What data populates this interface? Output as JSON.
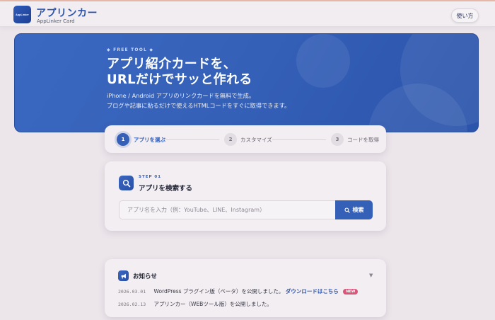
{
  "header": {
    "logo_text": "AppLinker",
    "title": "アプリンカー",
    "subtitle": "AppLinker Card",
    "howto_label": "使い方"
  },
  "hero": {
    "tag": "FREE TOOL",
    "title_line1": "アプリ紹介カードを、",
    "title_line2": "URLだけでサッと作れる",
    "desc_line1": "iPhone / Android アプリのリンクカードを無料で生成。",
    "desc_line2": "ブログや記事に貼るだけで使えるHTMLコードをすぐに取得できます。"
  },
  "steps": [
    {
      "num": "1",
      "label": "アプリを選ぶ",
      "active": true
    },
    {
      "num": "2",
      "label": "カスタマイズ",
      "active": false
    },
    {
      "num": "3",
      "label": "コードを取得",
      "active": false
    }
  ],
  "search_card": {
    "step_tag": "STEP 01",
    "title": "アプリを検索する",
    "placeholder": "アプリ名を入力（例：YouTube、LINE、Instagram）",
    "button_label": "検索",
    "icon": "search-icon"
  },
  "news": {
    "title": "お知らせ",
    "toggle": "▼",
    "items": [
      {
        "date": "2026.03.01",
        "text": "WordPress プラグイン版（ベータ）を公開しました。",
        "link": "ダウンロードはこちら",
        "badge": "NEW"
      },
      {
        "date": "2026.02.13",
        "text": "アプリンカー（WEBツール版）を公開しました。",
        "link": "",
        "badge": ""
      }
    ]
  },
  "colors": {
    "accent": "#3560b8",
    "badge": "#d9557a",
    "background": "#ece6eb"
  }
}
